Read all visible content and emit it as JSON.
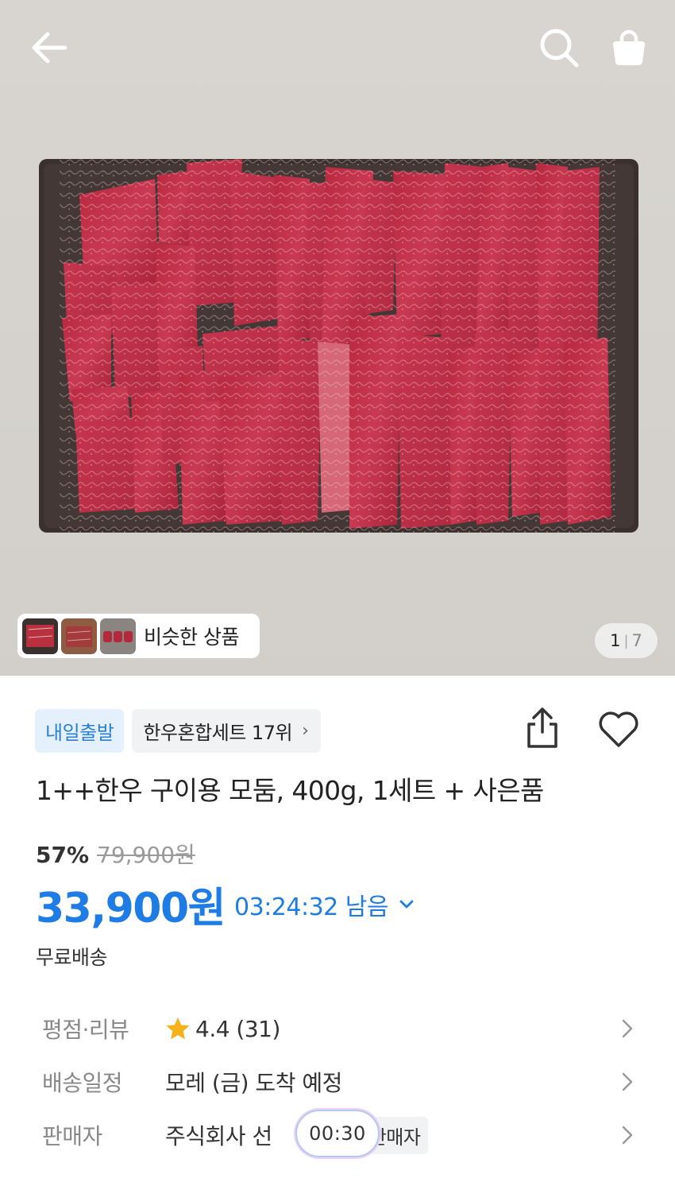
{
  "hero": {
    "similar_label": "비슷한 상품",
    "page_current": "1",
    "page_separator": "|",
    "page_total": "7"
  },
  "badges": {
    "delivery": "내일출발",
    "ranking": "한우혼합세트 17위",
    "ranking_chevron": "›"
  },
  "product": {
    "title": "1++한우 구이용 모둠, 400g, 1세트 + 사은품",
    "discount_rate": "57%",
    "original_price": "79,900원",
    "sale_price": "33,900원",
    "timer": "03:24:32 남음",
    "shipping": "무료배송"
  },
  "info": {
    "rating_label": "평점·리뷰",
    "rating_value": "4.4 (31)",
    "delivery_label": "배송일정",
    "delivery_value": "모레 (금) 도착 예정",
    "seller_label": "판매자",
    "seller_value": "주식회사 선",
    "seller_tag": "판매자"
  },
  "overlay": {
    "timer": "00:30"
  },
  "colors": {
    "accent_blue": "#1e7ce4",
    "badge_blue_bg": "#e4f0fb",
    "star": "#f5b21b"
  },
  "icons": [
    "back-arrow-icon",
    "search-icon",
    "shopping-bag-icon",
    "share-icon",
    "heart-icon",
    "chevron-down-icon",
    "chevron-right-icon",
    "star-icon"
  ]
}
